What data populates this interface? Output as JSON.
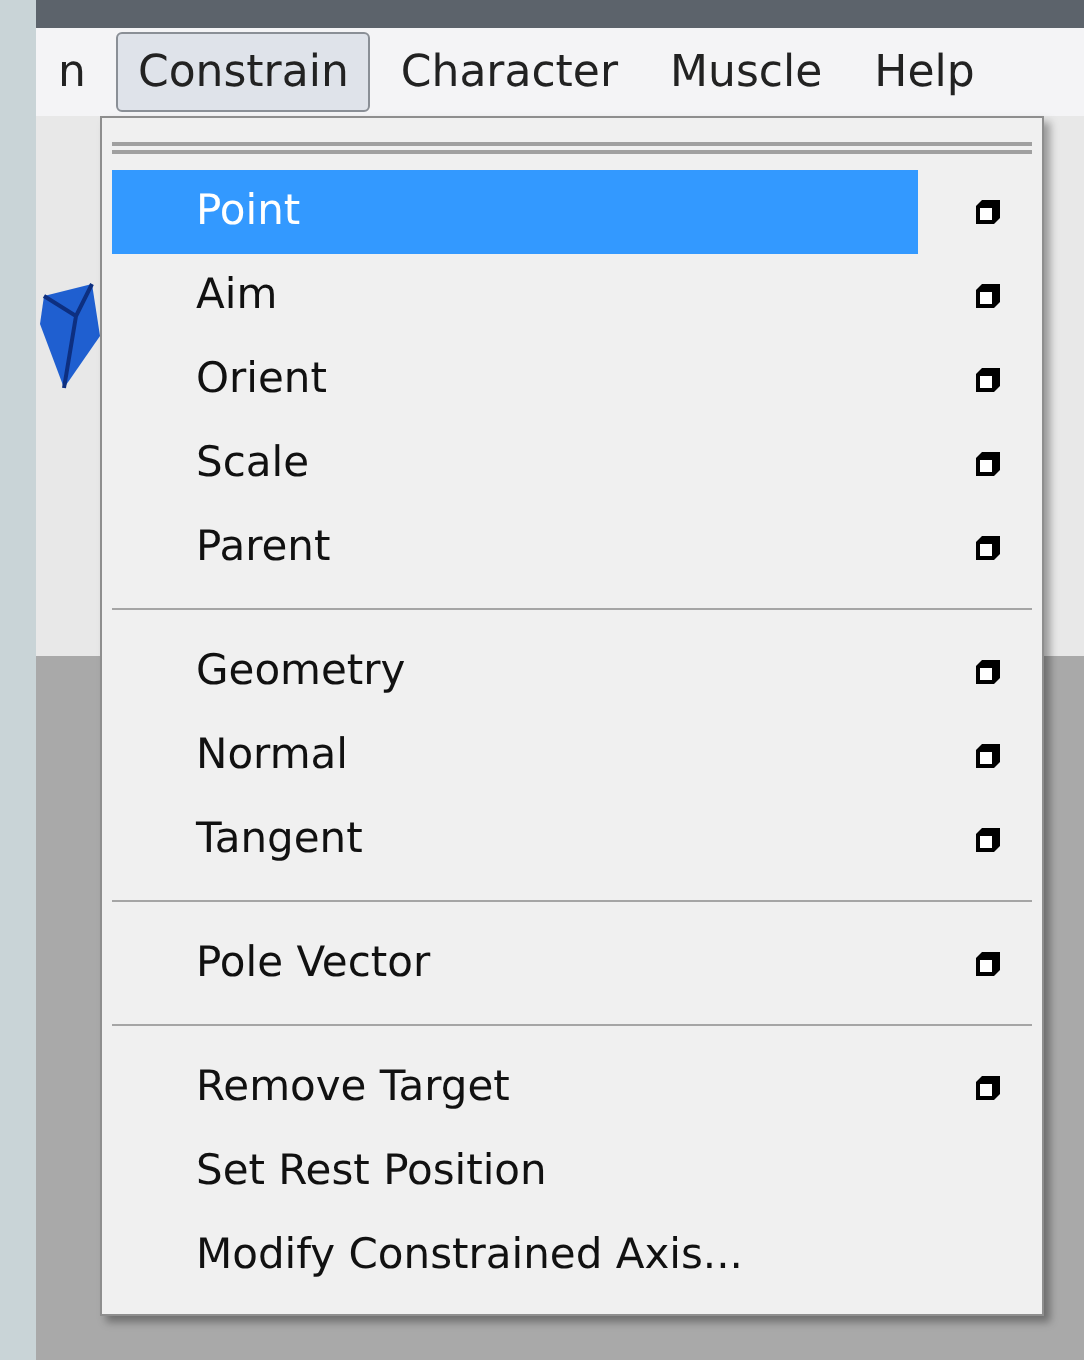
{
  "menu_bar": [
    {
      "label": "n",
      "selected": false
    },
    {
      "label": "Constrain",
      "selected": true
    },
    {
      "label": "Character",
      "selected": false
    },
    {
      "label": "Muscle",
      "selected": false
    },
    {
      "label": "Help",
      "selected": false
    }
  ],
  "menu": {
    "sections": [
      [
        {
          "label": "Point",
          "selected": true,
          "option_box": true
        },
        {
          "label": "Aim",
          "selected": false,
          "option_box": true
        },
        {
          "label": "Orient",
          "selected": false,
          "option_box": true
        },
        {
          "label": "Scale",
          "selected": false,
          "option_box": true
        },
        {
          "label": "Parent",
          "selected": false,
          "option_box": true
        }
      ],
      [
        {
          "label": "Geometry",
          "selected": false,
          "option_box": true
        },
        {
          "label": "Normal",
          "selected": false,
          "option_box": true
        },
        {
          "label": "Tangent",
          "selected": false,
          "option_box": true
        }
      ],
      [
        {
          "label": "Pole Vector",
          "selected": false,
          "option_box": true
        }
      ],
      [
        {
          "label": "Remove Target",
          "selected": false,
          "option_box": true
        },
        {
          "label": "Set Rest Position",
          "selected": false,
          "option_box": false
        },
        {
          "label": "Modify Constrained Axis...",
          "selected": false,
          "option_box": false
        }
      ]
    ]
  }
}
